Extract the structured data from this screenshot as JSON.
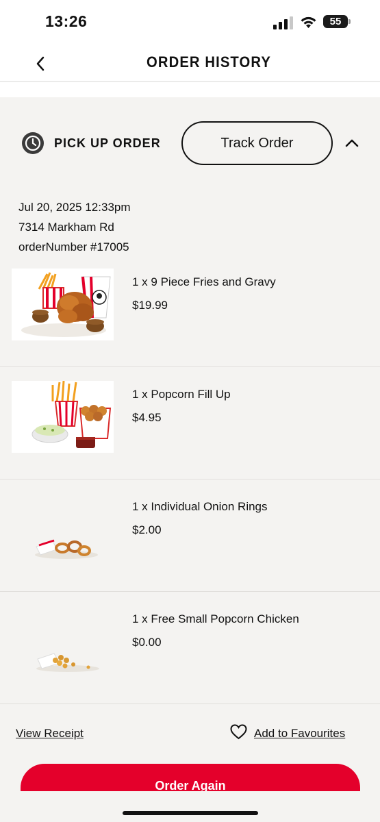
{
  "status_bar": {
    "time": "13:26",
    "battery": "55",
    "icons": [
      "signal-icon",
      "wifi-icon",
      "battery-icon"
    ]
  },
  "header": {
    "title": "ORDER HISTORY",
    "back_icon": "chevron-left-icon"
  },
  "order": {
    "type_icon": "clock-icon",
    "type_label": "PICK UP ORDER",
    "track_button_label": "Track Order",
    "collapse_icon": "chevron-up-icon",
    "date": "Jul 20, 2025 12:33pm",
    "address": "7314 Markham Rd",
    "order_number": "orderNumber #17005",
    "items": [
      {
        "name": "1 x 9 Piece Fries and Gravy",
        "price": "$19.99",
        "image": "fried-chicken-bucket-image"
      },
      {
        "name": "1 x Popcorn Fill Up",
        "price": "$4.95",
        "image": "popcorn-chicken-meal-image"
      },
      {
        "name": "1 x Individual Onion Rings",
        "price": "$2.00",
        "image": "onion-rings-image"
      },
      {
        "name": "1 x Free Small Popcorn Chicken",
        "price": "$0.00",
        "image": "small-popcorn-chicken-image"
      }
    ]
  },
  "footer": {
    "view_receipt_label": "View Receipt",
    "favourites_icon": "heart-icon",
    "add_favourites_label": "Add to Favourites",
    "order_again_label": "Order Again"
  },
  "colors": {
    "accent": "#e4002b",
    "background": "#f4f3f1",
    "header_background": "#ffffff",
    "text": "#111111"
  }
}
